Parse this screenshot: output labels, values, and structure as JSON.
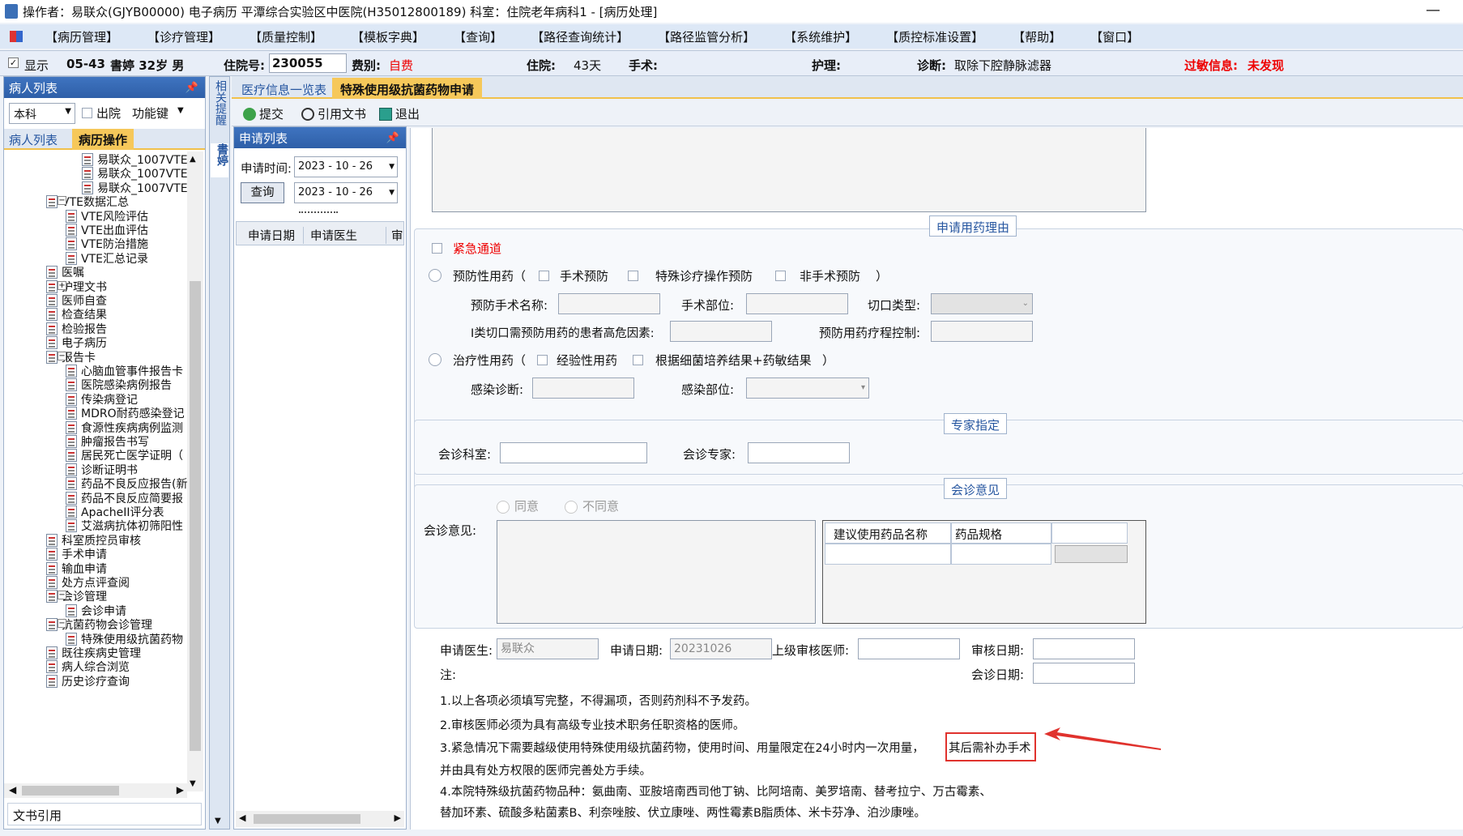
{
  "window": {
    "title": "操作者：易联众(GJYB00000) 电子病历  平潭综合实验区中医院(H35012800189)  科室：住院老年病科1 - [病历处理]",
    "minimize": "—"
  },
  "menu": [
    "【病历管理】",
    "【诊疗管理】",
    "【质量控制】",
    "【模板字典】",
    "【查询】",
    "【路径查询统计】",
    "【路径监管分析】",
    "【系统维护】",
    "【质控标准设置】",
    "【帮助】",
    "【窗口】"
  ],
  "patient": {
    "show_label": "显示",
    "bed": "05-43",
    "name_age_sex": "書婷 32岁 男",
    "admission_no_label": "住院号:",
    "admission_no": "230055",
    "fee_label": "费别:",
    "fee": "自费",
    "stay_label": "住院:",
    "stay": "43天",
    "surgery_label": "手术:",
    "nursing_label": "护理:",
    "diagnosis_label": "诊断:",
    "diagnosis": "取除下腔静脉滤器",
    "allergy_label": "过敏信息:",
    "allergy": "未发现"
  },
  "left_panel": {
    "header": "病人列表",
    "dept_select": "本科",
    "discharge_label": "出院",
    "function_key": "功能键",
    "tabs": [
      "病人列表",
      "病历操作"
    ],
    "tree": [
      "易联众_1007VTE防",
      "易联众_1007VTE防",
      "易联众_1007VTE防",
      "VTE数据汇总",
      "VTE风险评估",
      "VTE出血评估",
      "VTE防治措施",
      "VTE汇总记录",
      "医嘱",
      "护理文书",
      "医师自查",
      "检查结果",
      "检验报告",
      "电子病历",
      "报告卡",
      "心脑血管事件报告卡",
      "医院感染病例报告",
      "传染病登记",
      "MDRO耐药感染登记",
      "食源性疾病病例监测",
      "肿瘤报告书写",
      "居民死亡医学证明（",
      "诊断证明书",
      "药品不良反应报告(新",
      "药品不良反应简要报",
      "ApacheII评分表",
      "艾滋病抗体初筛阳性",
      "科室质控员审核",
      "手术申请",
      "输血申请",
      "处方点评查阅",
      "会诊管理",
      "会诊申请",
      "抗菌药物会诊管理",
      "特殊使用级抗菌药物",
      "既往疾病史管理",
      "病人综合浏览",
      "历史诊疗查询"
    ],
    "footer": "文书引用"
  },
  "side_tabs": [
    "相关提醒",
    "書婷"
  ],
  "tabs": [
    "医疗信息一览表",
    "特殊使用级抗菌药物申请"
  ],
  "toolbar": {
    "submit": "提交",
    "cite": "引用文书",
    "exit": "退出"
  },
  "app_list": {
    "header": "申请列表",
    "time_label": "申请时间:",
    "date_from": "2023 - 10 - 26",
    "query": "查询",
    "date_to": "2023 - 10 - 26",
    "columns": [
      "申请日期",
      "申请医生",
      "审"
    ]
  },
  "reason": {
    "title": "申请用药理由",
    "emergency": "紧急通道",
    "prophylactic": "预防性用药（",
    "surgical_prevention": "手术预防",
    "special_op_prevention": "特殊诊疗操作预防",
    "non_surgical_prevention": "非手术预防",
    "close_paren": "）",
    "prev_surgery_name": "预防手术名称:",
    "surgery_site": "手术部位:",
    "incision_type": "切口类型:",
    "risk_factors": "I类切口需预防用药的患者高危因素:",
    "course_control": "预防用药疗程控制:",
    "therapeutic": "治疗性用药（",
    "empirical": "经验性用药",
    "culture_based": "根据细菌培养结果+药敏结果",
    "infection_dx": "感染诊断:",
    "infection_site": "感染部位:"
  },
  "expert": {
    "title": "专家指定",
    "dept_label": "会诊科室:",
    "expert_label": "会诊专家:"
  },
  "opinion": {
    "title": "会诊意见",
    "agree": "同意",
    "disagree": "不同意",
    "label": "会诊意见:",
    "drug_columns": [
      "建议使用药品名称",
      "药品规格"
    ]
  },
  "signature": {
    "applicant_label": "申请医生:",
    "applicant": "易联众",
    "apply_date_label": "申请日期:",
    "apply_date": "20231026",
    "reviewer_label": "上级审核医师:",
    "review_date_label": "审核日期:",
    "consult_date_label": "会诊日期:",
    "note_label": "注:"
  },
  "notes": [
    "1.以上各项必须填写完整，不得漏项，否则药剂科不予发药。",
    "2.审核医师必须为具有高级专业技术职务任职资格的医师。",
    "3.紧急情况下需要越级使用特殊使用级抗菌药物，使用时间、用量限定在24小时内一次用量，",
    "其后需补办手术",
    "并由具有处方权限的医师完善处方手续。",
    "4.本院特殊级抗菌药物品种：氨曲南、亚胺培南西司他丁钠、比阿培南、美罗培南、替考拉宁、万古霉素、",
    "替加环素、硫酸多粘菌素B、利奈唑胺、伏立康唑、两性霉素B脂质体、米卡芬净、泊沙康唑。"
  ],
  "colors": {
    "highlight_box": "#e0322d",
    "active_tab": "#f6c85a",
    "header_blue": "#2e5fa8"
  }
}
